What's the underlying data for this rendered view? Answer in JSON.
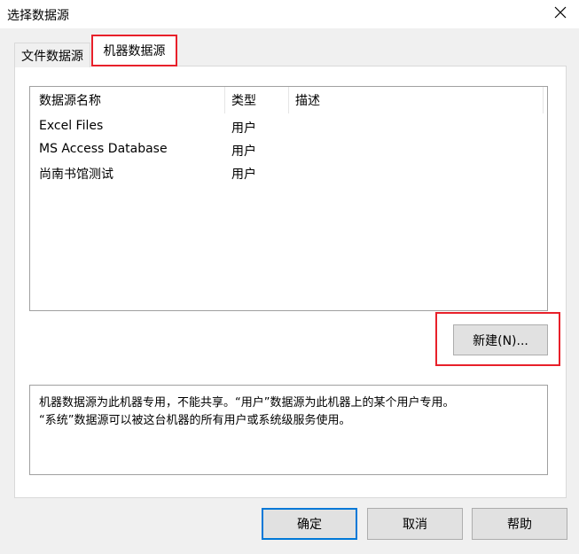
{
  "window": {
    "title": "选择数据源"
  },
  "tabs": [
    {
      "label": "文件数据源"
    },
    {
      "label": "机器数据源"
    }
  ],
  "list": {
    "headers": {
      "name": "数据源名称",
      "type": "类型",
      "desc": "描述"
    },
    "rows": [
      {
        "name": "Excel Files",
        "type": "用户",
        "desc": ""
      },
      {
        "name": "MS Access Database",
        "type": "用户",
        "desc": ""
      },
      {
        "name": "尚南书馆测试",
        "type": "用户",
        "desc": ""
      }
    ]
  },
  "buttons": {
    "new": "新建(N)...",
    "ok": "确定",
    "cancel": "取消",
    "help": "帮助"
  },
  "description": {
    "line1": "机器数据源为此机器专用，不能共享。“用户”数据源为此机器上的某个用户专用。",
    "line2": "“系统”数据源可以被这台机器的所有用户或系统级服务使用。"
  },
  "colors": {
    "highlight_frame": "#e8202a",
    "default_button_border": "#0078d7"
  },
  "icons": {
    "close": "close-icon"
  }
}
